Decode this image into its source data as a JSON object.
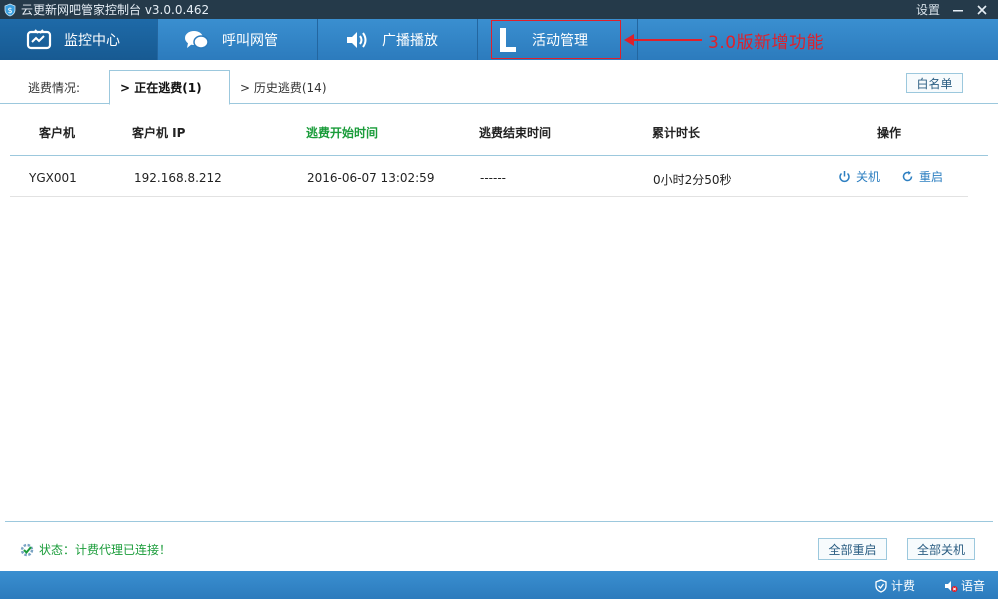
{
  "window": {
    "title": "云更新网吧管家控制台  v3.0.0.462",
    "settings_label": "设置"
  },
  "nav": {
    "tabs": [
      {
        "label": "监控中心",
        "icon": "monitor-icon",
        "active": true
      },
      {
        "label": "呼叫网管",
        "icon": "chat-icon",
        "active": false
      },
      {
        "label": "广播播放",
        "icon": "speaker-icon",
        "active": false
      },
      {
        "label": "活动管理",
        "icon": "letter-l-icon",
        "active": false
      }
    ],
    "annotation": "3.0版新增功能"
  },
  "subtabs": {
    "label": "逃费情况:",
    "current": "> 正在逃费(1)",
    "history": "> 历史逃费(14)",
    "whitelist_button": "白名单"
  },
  "table": {
    "headers": [
      "客户机",
      "客户机 IP",
      "逃费开始时间",
      "逃费结束时间",
      "累计时长",
      "操作"
    ],
    "rows": [
      {
        "client": "YGX001",
        "ip": "192.168.8.212",
        "start": "2016-06-07 13:02:59",
        "end": "------",
        "duration": "0小时2分50秒",
        "shutdown": "关机",
        "restart": "重启"
      }
    ]
  },
  "status": {
    "text": "状态：计费代理已连接！",
    "restart_all": "全部重启",
    "shutdown_all": "全部关机"
  },
  "bottombar": {
    "billing": "计费",
    "voice": "语音"
  },
  "colors": {
    "accent": "#2c7bbd",
    "green": "#1a9c3a",
    "annotation_red": "#e0202a"
  }
}
